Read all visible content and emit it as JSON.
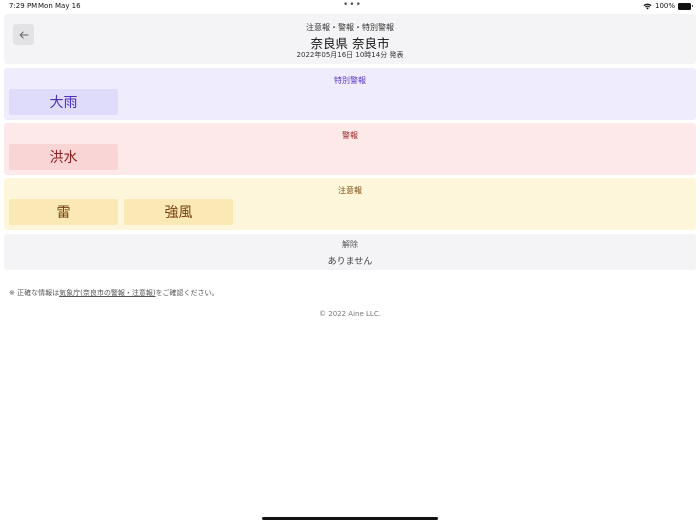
{
  "status_bar": {
    "time": "7:29 PM",
    "date": "Mon May 16",
    "dots": "•••",
    "battery": "100%"
  },
  "header": {
    "subtitle": "注意報・警報・特別警報",
    "title": "奈良県 奈良市",
    "issued": "2022年05月16日 10時14分 発表",
    "back_icon": "arrow-left-icon"
  },
  "special_warning": {
    "title": "特別警報",
    "items": [
      "大雨"
    ]
  },
  "warning": {
    "title": "警報",
    "items": [
      "洪水"
    ]
  },
  "advisory": {
    "title": "注意報",
    "items": [
      "雷",
      "強風"
    ]
  },
  "cancelled": {
    "title": "解除",
    "value": "ありません"
  },
  "note": {
    "prefix": "※ 正確な情報は",
    "link": "気象庁(奈良市の警報・注意報)",
    "suffix": "をご確認ください。"
  },
  "copyright": "© 2022 Aine LLC.",
  "colors": {
    "special_bg": "#efedfd",
    "special_accent": "#5b35c9",
    "warning_bg": "#fde9e9",
    "warning_accent": "#9a2424",
    "advisory_bg": "#fdf6da",
    "advisory_accent": "#7a4a10"
  }
}
